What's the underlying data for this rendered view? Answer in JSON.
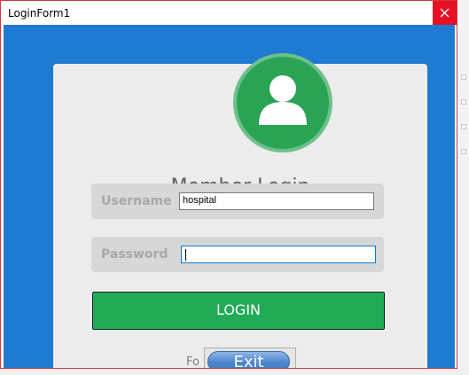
{
  "window": {
    "title": "LoginForm1"
  },
  "form": {
    "heading": "Member Login",
    "username_label": "Username",
    "username_value": "hospital",
    "password_label": "Password",
    "password_value": "",
    "login_label": "LOGIN",
    "forgot_partial": "Fo",
    "exit_label": "Exit"
  },
  "icons": {
    "avatar": "user-icon",
    "close": "close-icon"
  },
  "colors": {
    "client_bg": "#1f7bd1",
    "card_bg": "#ececec",
    "accent_green": "#22ab57",
    "close_red": "#e81123"
  }
}
